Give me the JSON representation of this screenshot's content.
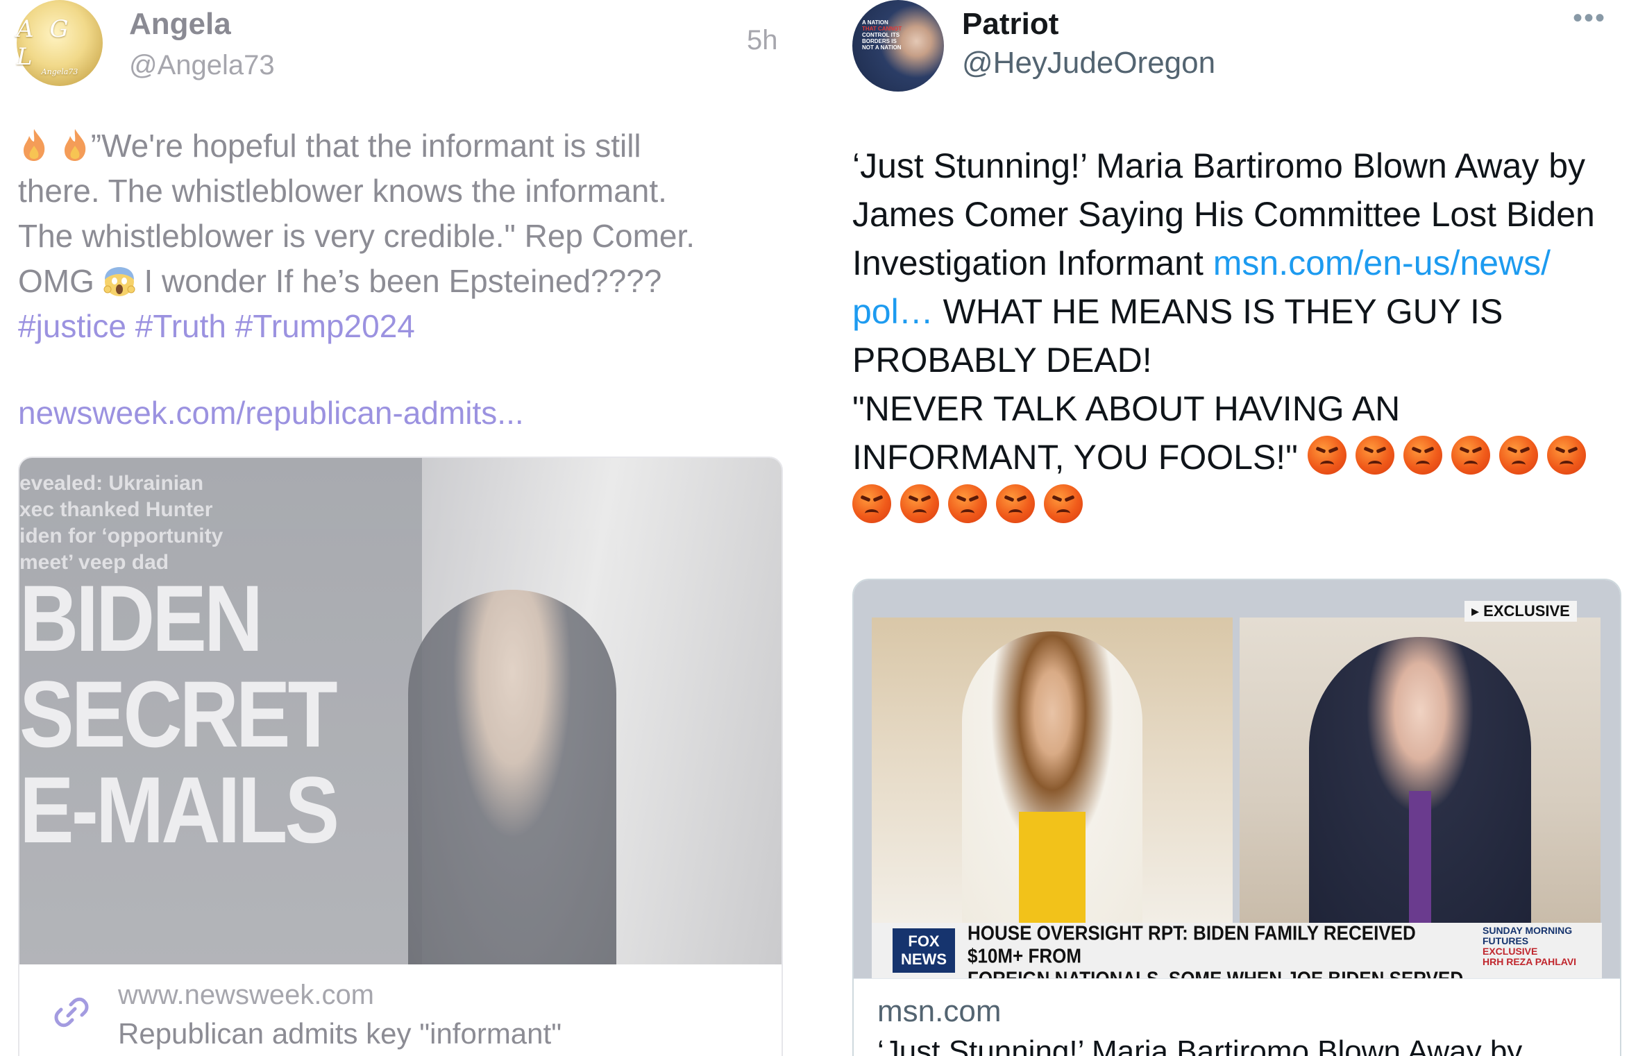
{
  "left_post": {
    "avatar_text": "A G L",
    "avatar_subtext": "Angela73",
    "name": "Angela",
    "handle": "@Angela73",
    "time": "5h",
    "body_lines": [
      "”We're hopeful that the informant is still",
      "there. The whistleblower knows the informant.",
      "The whistleblower is very credible.\" Rep Comer.",
      "OMG",
      "I wonder If he’s been Epsteined????"
    ],
    "hashtags": [
      "#justice",
      "#Truth",
      "#Trump2024"
    ],
    "link": "newsweek.com/republican-admits...",
    "card": {
      "image_headline": [
        "evealed: Ukrainian",
        "xec thanked Hunter",
        "iden for ‘opportunity",
        "meet’ veep dad"
      ],
      "image_big_text": [
        "BIDEN",
        "SECRET",
        "E-MAILS"
      ],
      "domain": "www.newsweek.com",
      "title": "Republican admits key \"informant\""
    }
  },
  "right_post": {
    "avatar_text": [
      "A NATION",
      "THAT CANNOT",
      "CONTROL ITS",
      "BORDERS IS",
      "NOT A NATION"
    ],
    "name": "Patriot",
    "handle": "@HeyJudeOregon",
    "more_label": "•••",
    "body": {
      "line1": "‘Just Stunning!’ Maria Bartiromo Blown Away by",
      "line2": "James Comer Saying His Committee Lost Biden",
      "line3_text": "Investigation Informant ",
      "line3_link": "msn.com/en-us/news/",
      "line4_link": "pol…",
      "line4_text": " WHAT HE MEANS IS THEY GUY IS",
      "line5": "PROBABLY DEAD!",
      "line6": "\"NEVER TALK ABOUT HAVING AN",
      "line7": "INFORMANT, YOU FOOLS!\""
    },
    "card": {
      "exclusive_label": "▸ EXCLUSIVE",
      "fox_logo": "FOX NEWS",
      "chyron_line1": "HOUSE OVERSIGHT RPT: BIDEN FAMILY RECEIVED $10M+ FROM",
      "chyron_line2": "FOREIGN NATIONALS, SOME WHEN JOE BIDEN SERVED AS VP",
      "sunday_label": "SUNDAY MORNING FUTURES",
      "sunday_exclusive": "EXCLUSIVE",
      "sunday_guest": "HRH REZA PAHLAVI",
      "domain": "msn.com",
      "title": "‘Just Stunning!’ Maria Bartiromo Blown Away by"
    }
  },
  "icons": [
    "fire-icon",
    "scream-face-icon",
    "angry-face-icon",
    "link-icon",
    "more-icon"
  ],
  "colors": {
    "left_accent": "#9b92e0",
    "right_link": "#1d9bf0",
    "right_text": "#0f1419",
    "left_text": "#8c8c94"
  }
}
